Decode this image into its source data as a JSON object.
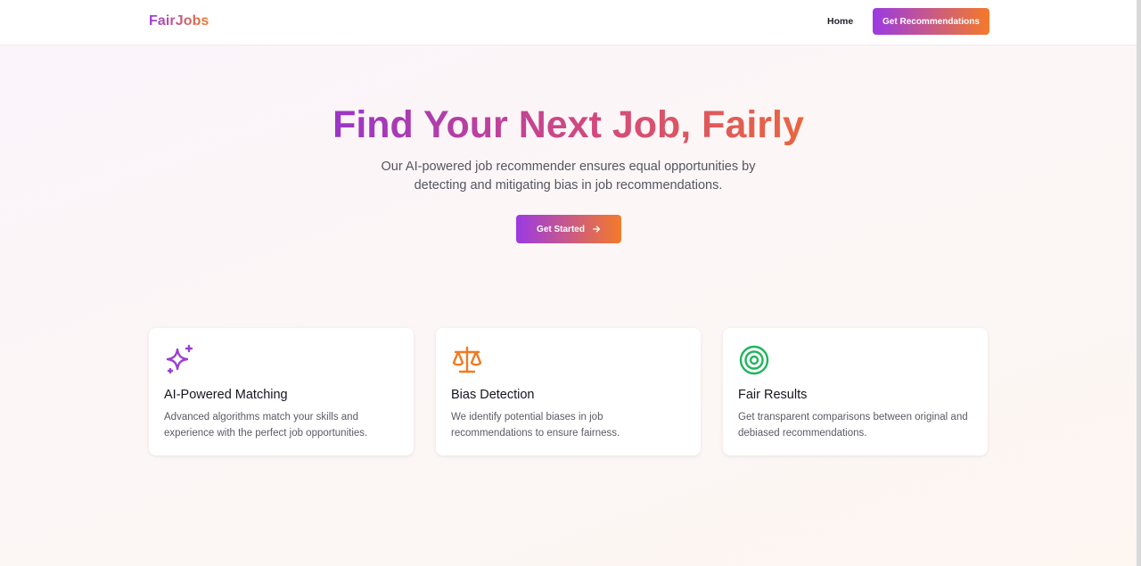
{
  "header": {
    "logo": "FairJobs",
    "nav_home": "Home",
    "cta_label": "Get Recommendations"
  },
  "hero": {
    "title": "Find Your Next Job, Fairly",
    "subtitle_line1": "Our AI-powered job recommender ensures equal opportunities by",
    "subtitle_line2": "detecting and mitigating bias in job recommendations.",
    "button_label": "Get Started",
    "button_icon": "arrow-right-icon"
  },
  "features": [
    {
      "icon": "sparkles-icon",
      "icon_color": "#9b3fd6",
      "title": "AI-Powered Matching",
      "description": "Advanced algorithms match your skills and experience with the perfect job opportunities."
    },
    {
      "icon": "scale-icon",
      "icon_color": "#f07a22",
      "title": "Bias Detection",
      "description": "We identify potential biases in job recommendations to ensure fairness."
    },
    {
      "icon": "target-icon",
      "icon_color": "#22b45e",
      "title": "Fair Results",
      "description": "Get transparent comparisons between original and debiased recommendations."
    }
  ],
  "colors": {
    "gradient_start": "#9b3ae3",
    "gradient_end": "#f47a2a"
  }
}
